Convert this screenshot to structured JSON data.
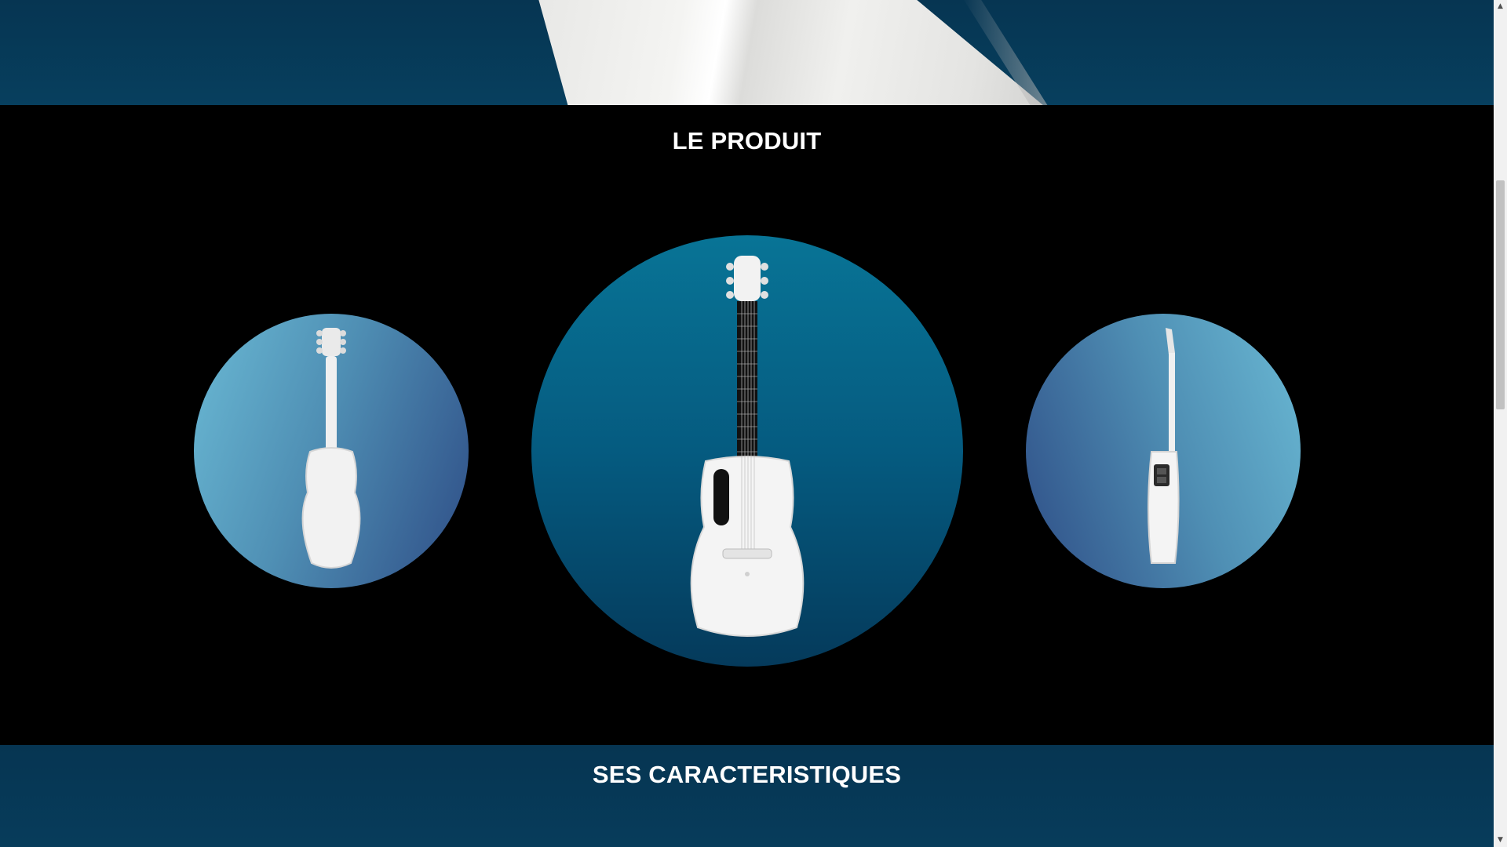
{
  "sections": {
    "product_title": "LE PRODUIT",
    "features_title": "SES CARACTERISTIQUES"
  },
  "gallery": {
    "views": [
      "back",
      "front",
      "side"
    ]
  },
  "colors": {
    "band": "#063552",
    "background": "#000000",
    "center_circle": "#087496",
    "side_circle_light": "#6ab9d4",
    "side_circle_dark": "#2e4d86",
    "title_text": "#ffffff"
  },
  "scrollbar": {
    "up_icon": "scroll-up-arrow",
    "down_icon": "scroll-down-arrow"
  }
}
